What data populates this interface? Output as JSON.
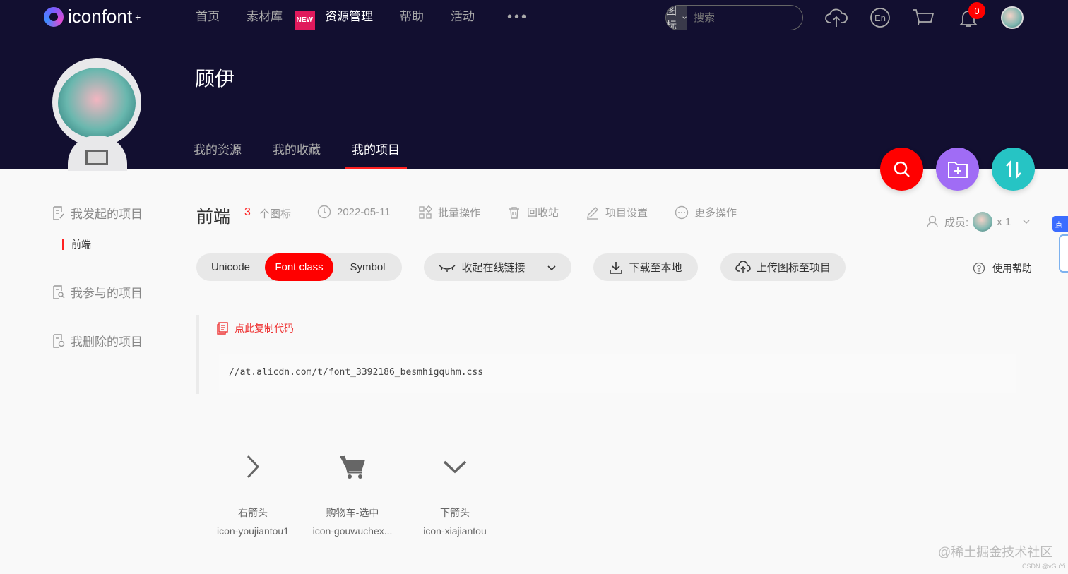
{
  "brand": {
    "name": "iconfont",
    "sup": "+"
  },
  "nav": {
    "items": [
      "首页",
      "素材库",
      "资源管理",
      "帮助",
      "活动"
    ],
    "new_badge": "NEW",
    "more": "•••"
  },
  "search": {
    "type": "图标",
    "placeholder": "搜索"
  },
  "header": {
    "notification_count": "0"
  },
  "profile": {
    "name": "顾伊",
    "tabs": [
      "我的资源",
      "我的收藏",
      "我的项目"
    ]
  },
  "sidebar": {
    "items": [
      "我发起的项目",
      "我参与的项目",
      "我删除的项目"
    ],
    "sub_item": "前端"
  },
  "project": {
    "title": "前端",
    "count": "3",
    "count_unit": "个图标",
    "date": "2022-05-11",
    "actions": [
      "批量操作",
      "回收站",
      "项目设置",
      "更多操作"
    ],
    "members_label": "成员:",
    "members_count": "x 1"
  },
  "toolbar": {
    "segments": [
      "Unicode",
      "Font class",
      "Symbol"
    ],
    "active_segment": "Font class",
    "online_link": "收起在线链接",
    "download": "下载至本地",
    "upload": "上传图标至项目",
    "help": "使用帮助"
  },
  "code": {
    "copy_label": "点此复制代码",
    "url": "//at.alicdn.com/t/font_3392186_besmhigquhm.css"
  },
  "icons": [
    {
      "name": "右箭头",
      "class": "icon-youjiantou1",
      "glyph": "chevron-right-icon"
    },
    {
      "name": "购物车-选中",
      "class": "icon-gouwuchex...",
      "glyph": "cart-icon"
    },
    {
      "name": "下箭头",
      "class": "icon-xiajiantou",
      "glyph": "chevron-down-icon"
    }
  ],
  "floating": {
    "badge": "点"
  },
  "watermark": {
    "main": "@稀土掘金技术社区",
    "small": "CSDN @vGuYi"
  },
  "colors": {
    "header_bg": "#120f30",
    "accent_red": "#ff0000",
    "fab_purple": "#a06cf5",
    "fab_teal": "#26c4c4"
  }
}
